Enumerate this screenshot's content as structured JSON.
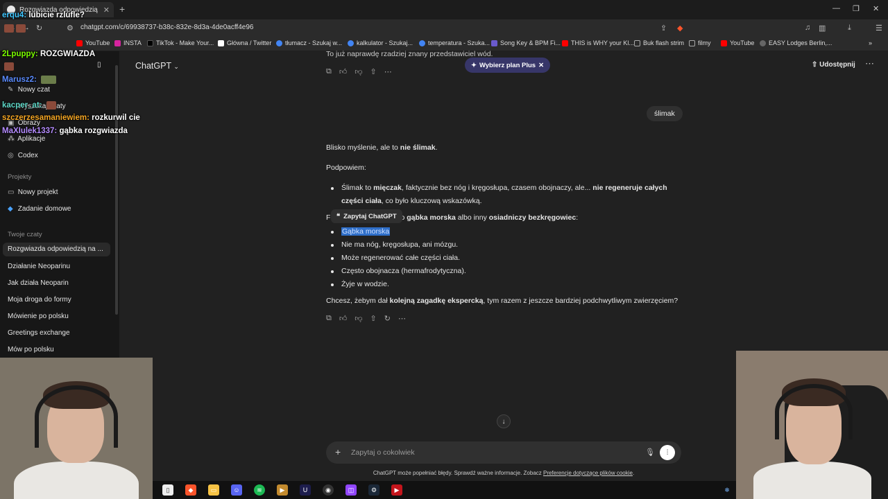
{
  "browser": {
    "tab_title": "Rozgwiazda odpowiedzią na py",
    "url": "chatgpt.com/c/69938737-b38c-832e-8d3a-4de0acff4e96",
    "bookmarks": [
      {
        "label": "YouTube",
        "color": "#ff0000"
      },
      {
        "label": "INSTA",
        "color": "#d6249f"
      },
      {
        "label": "TikTok - Make Your...",
        "color": "#000000"
      },
      {
        "label": "Główna / Twitter",
        "color": "#ffffff"
      },
      {
        "label": "tłumacz - Szukaj w...",
        "color": "#4285f4"
      },
      {
        "label": "kalkulator - Szukaj...",
        "color": "#4285f4"
      },
      {
        "label": "temperatura - Szuka...",
        "color": "#4285f4"
      },
      {
        "label": "Song Key & BPM Fi...",
        "color": "#6a5acd"
      },
      {
        "label": "THIS is WHY your Kl...",
        "color": "#ff0000"
      },
      {
        "label": "Buk flash strim",
        "color": "#888888"
      },
      {
        "label": "filmy",
        "color": "#888888"
      },
      {
        "label": "YouTube",
        "color": "#ff0000"
      },
      {
        "label": "EASY Lodges Berlin,...",
        "color": "#666666"
      }
    ]
  },
  "sidebar": {
    "top_items": [
      "Nowy czat",
      "Wyszukaj czaty",
      "Obrazy",
      "Aplikacje",
      "Codex"
    ],
    "projects_label": "Projekty",
    "projects": [
      "Nowy projekt",
      "Zadanie domowe"
    ],
    "chats_label": "Twoje czaty",
    "chats": [
      "Rozgwiazda odpowiedzią na ...",
      "Działanie Neoparinu",
      "Jak działa Neoparin",
      "Moja droga do formy",
      "Mówienie po polsku",
      "Greetings exchange",
      "Mów po polsku"
    ]
  },
  "header": {
    "model": "ChatGPT",
    "plus_label": "Wybierz plan Plus",
    "share_label": "Udostępnij"
  },
  "conversation": {
    "top_cut": "To już naprawdę rzadziej znany przedstawiciel wód.",
    "user_msg": "ślimak",
    "p1_a": "Blisko myślenie, ale to ",
    "p1_b": "nie ślimak",
    "p1_c": ".",
    "p2": "Podpowiem:",
    "b1_a": "Ślimak to ",
    "b1_b": "mięczak",
    "b1_c": ", faktycznie bez nóg i kręgosłupa, czasem obojnaczy, ale... ",
    "b1_d": "nie regeneruje całych",
    "b1_e": "części ciała",
    "b1_f": ", co było kluczową wskazówką.",
    "p3_a": "F",
    "p3_b": "ż to ",
    "p3_c": "gąbka morska",
    "p3_d": " albo inny ",
    "p3_e": "osiadniczy bezkręgowiec",
    "p3_f": ":",
    "ask_popup": "Zapytaj ChatGPT",
    "list": [
      "Gąbka morska",
      "Nie ma nóg, kręgosłupa, ani mózgu.",
      "Może regenerować całe części ciała.",
      "Często obojnacza (hermafrodytyczna).",
      "Żyje w wodzie."
    ],
    "p4_a": "Chcesz, żebym dał ",
    "p4_b": "kolejną zagadkę ekspercką",
    "p4_c": ", tym razem z jeszcze bardziej podchwytliwym zwierzęciem?"
  },
  "composer": {
    "placeholder": "Zapytaj o cokolwiek",
    "disclaimer_a": "ChatGPT może popełniać błędy. Sprawdź ważne informacje. Zobacz ",
    "disclaimer_link": "Preferencje dotyczące plików cookie",
    "disclaimer_b": "."
  },
  "overlay_chat": [
    {
      "user": "erqu4:",
      "msg": "lubicie rzlufle?",
      "color": "#3ec6ff"
    },
    {
      "user": "2Lpuppy:",
      "msg": "ROZGWIAZDA",
      "color": "#7cfc00"
    },
    {
      "user": "Marusz2:",
      "msg": "",
      "color": "#5b8cff"
    },
    {
      "user": "kacper_at:",
      "msg": "",
      "color": "#5dd6c6"
    },
    {
      "user": "szczerzesamaniewiem:",
      "msg": "rozkurwil cie",
      "color": "#f5a623"
    },
    {
      "user": "MaXIulek1337:",
      "msg": "gąbka rozgwiazda",
      "color": "#b58cff"
    }
  ]
}
